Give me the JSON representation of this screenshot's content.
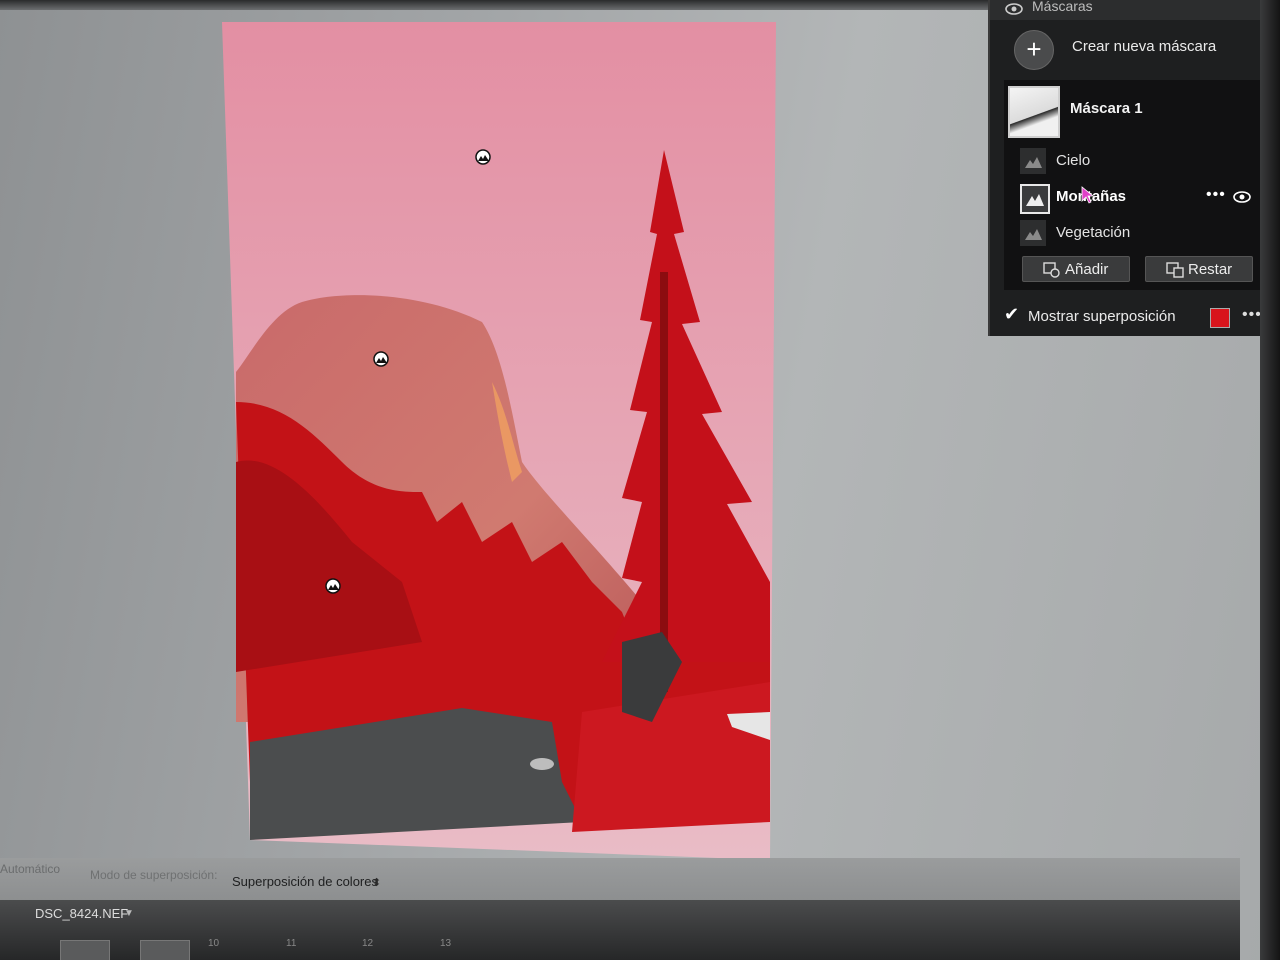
{
  "masks_panel": {
    "title": "Máscaras",
    "create_label": "Crear nueva máscara",
    "mask_name": "Máscara 1",
    "components": [
      {
        "label": "Cielo",
        "active": false
      },
      {
        "label": "Montañas",
        "active": true
      },
      {
        "label": "Vegetación",
        "active": false
      }
    ],
    "add_label": "Añadir",
    "subtract_label": "Restar",
    "show_overlay_label": "Mostrar superposición",
    "overlay_color": "#d8141b",
    "overlay_checked": true
  },
  "toolbar": {
    "auto_label": "Automático",
    "mode_label": "Modo de superposición:",
    "mode_value": "Superposición de colores"
  },
  "filmstrip": {
    "file_name": "DSC_8424.NEF",
    "numbers": [
      "10",
      "11",
      "12",
      "13"
    ]
  },
  "icons": {
    "visibility": "eye-icon",
    "create": "plus-icon",
    "add": "add-mask-icon",
    "subtract": "subtract-mask-icon",
    "pin": "mask-pin-icon"
  }
}
